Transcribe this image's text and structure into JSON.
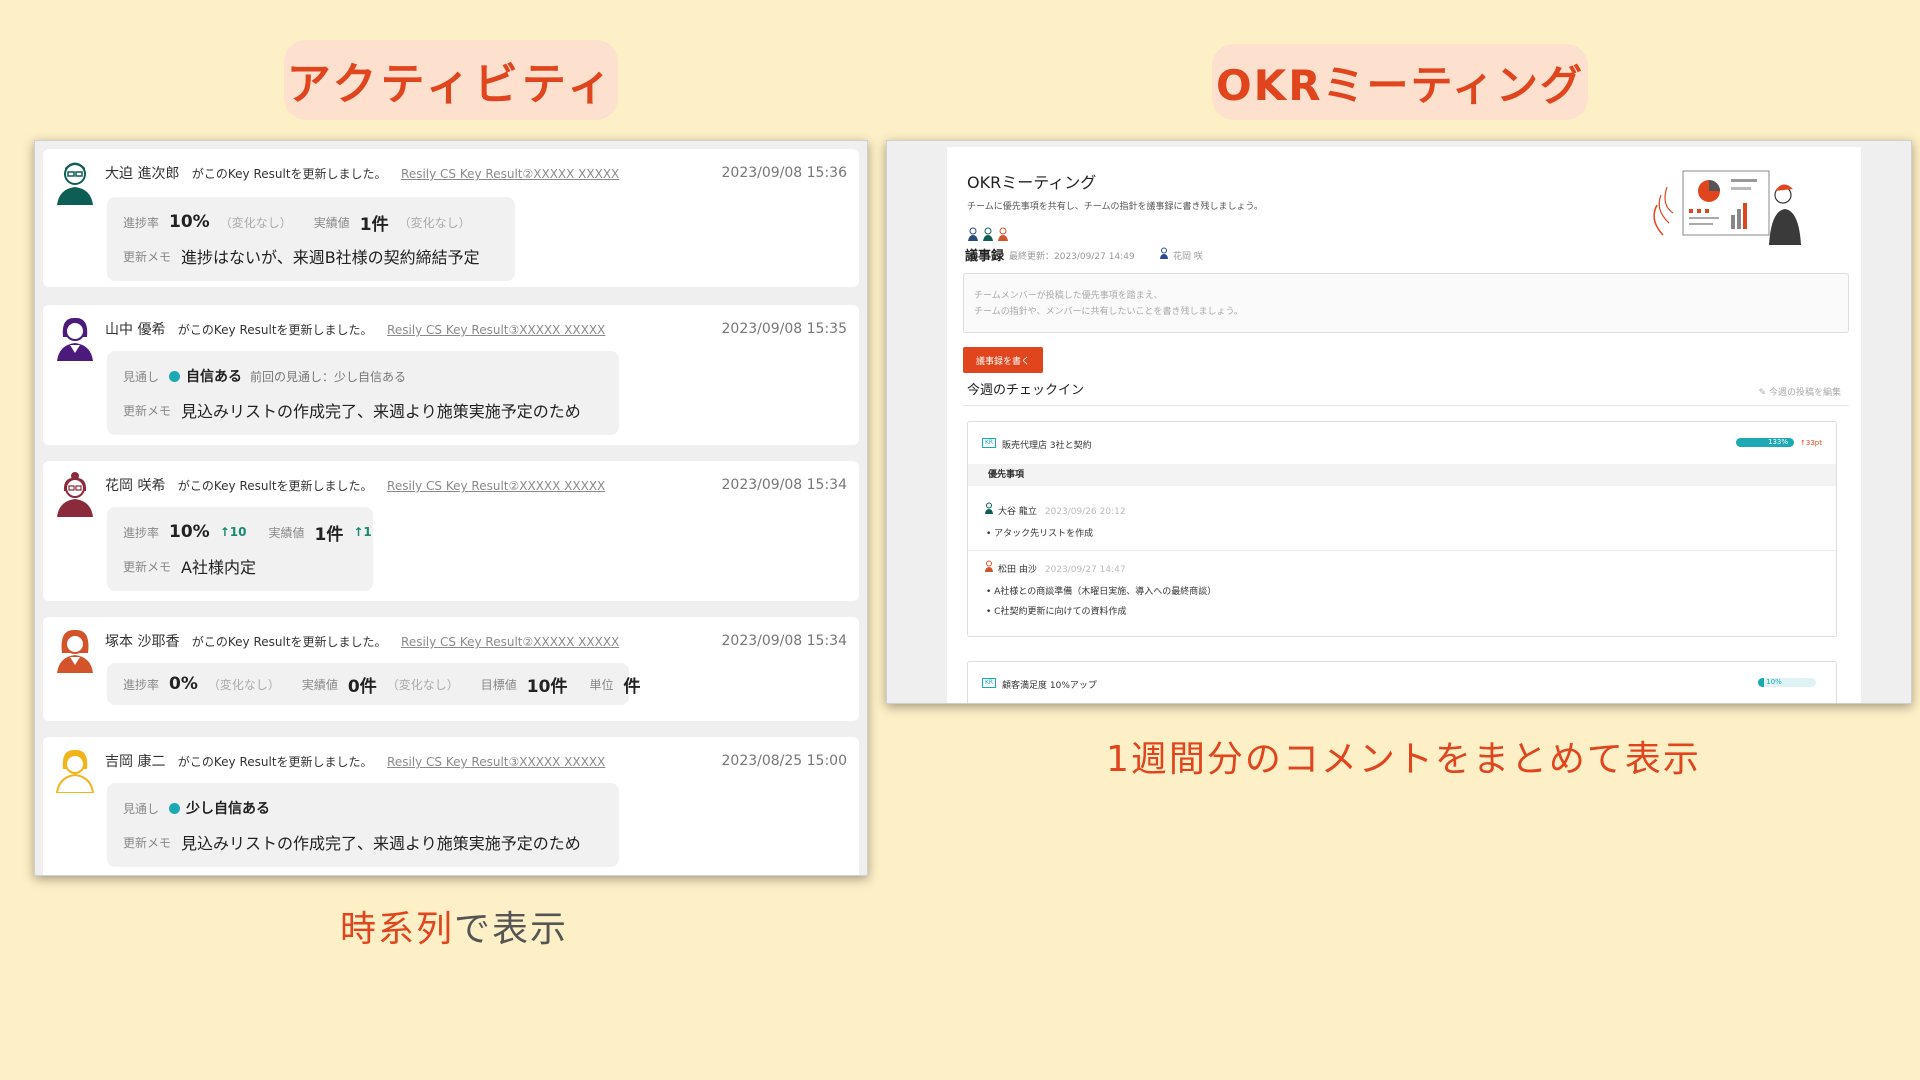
{
  "headings": {
    "activity": "アクティビティ",
    "okr": "OKRミーティング"
  },
  "captions": {
    "left_highlight": "時系列",
    "left_rest": "で表示",
    "right": "1週間分のコメントをまとめて表示"
  },
  "activity": {
    "action_text": "がこのKey Resultを更新しました。",
    "labels": {
      "progress": "進捗率",
      "actual": "実績値",
      "target": "目標値",
      "unit": "単位",
      "memo": "更新メモ",
      "outlook": "見通し"
    },
    "entries": [
      {
        "user": "大迫 進次郎",
        "kr": "Resily CS Key Result②XXXXX XXXXX",
        "time": "2023/09/08 15:36",
        "progress": "10%",
        "progress_note": "（変化なし）",
        "actual": "1件",
        "actual_note": "（変化なし）",
        "memo": "進捗はないが、来週B社様の契約締結予定"
      },
      {
        "user": "山中 優希",
        "kr": "Resily CS Key Result③XXXXX XXXXX",
        "time": "2023/09/08 15:35",
        "outlook": "自信ある",
        "prev_outlook": "前回の見通し：少し自信ある",
        "memo": "見込みリストの作成完了、来週より施策実施予定のため"
      },
      {
        "user": "花岡 咲希",
        "kr": "Resily CS Key Result②XXXXX XXXXX",
        "time": "2023/09/08 15:34",
        "progress": "10%",
        "progress_change": "↑10",
        "actual": "1件",
        "actual_change": "↑1",
        "memo": "A社様内定"
      },
      {
        "user": "塚本 沙耶香",
        "kr": "Resily CS Key Result②XXXXX XXXXX",
        "time": "2023/09/08 15:34",
        "progress": "0%",
        "progress_note": "（変化なし）",
        "actual": "0件",
        "actual_note": "（変化なし）",
        "target": "10件",
        "unit": "件"
      },
      {
        "user": "吉岡 康二",
        "kr": "Resily CS Key Result③XXXXX XXXXX",
        "time": "2023/08/25 15:00",
        "outlook": "少し自信ある",
        "memo": "見込みリストの作成完了、来週より施策実施予定のため"
      }
    ]
  },
  "okr_meeting": {
    "title": "OKRミーティング",
    "description": "チームに優先事項を共有し、チームの指針を議事録に書き残しましょう。",
    "minutes": {
      "title": "議事録",
      "last_updated": "最終更新：2023/09/27 14:49",
      "editor": "花岡 咲",
      "placeholder_line1": "チームメンバーが投稿した優先事項を踏まえ、",
      "placeholder_line2": "チームの指針や、メンバーに共有したいことを書き残しましょう。",
      "write_button": "議事録を書く"
    },
    "checkin": {
      "title": "今週のチェックイン",
      "edit_link": "今週の投稿を編集",
      "key_results": [
        {
          "tag": "KR",
          "title": "販売代理店 3社と契約",
          "percent": "133%",
          "percent_value": 1.0,
          "change": "↑33pt",
          "priority_header": "優先事項",
          "checkins": [
            {
              "user": "大谷 龍立",
              "time": "2023/09/26 20:12",
              "items": [
                "アタック先リストを作成"
              ]
            },
            {
              "user": "松田 由沙",
              "time": "2023/09/27 14:47",
              "items": [
                "A社様との商談準備（木曜日実施、導入への最終商談）",
                "C社契約更新に向けての資料作成"
              ]
            }
          ]
        },
        {
          "tag": "KR",
          "title": "顧客満足度 10%アップ",
          "percent": "10%",
          "percent_value": 0.1
        }
      ]
    }
  },
  "colors": {
    "background": "#fdefc6",
    "accent": "#e0451d",
    "pill": "#fde0cd",
    "teal": "#1ca9b4"
  }
}
